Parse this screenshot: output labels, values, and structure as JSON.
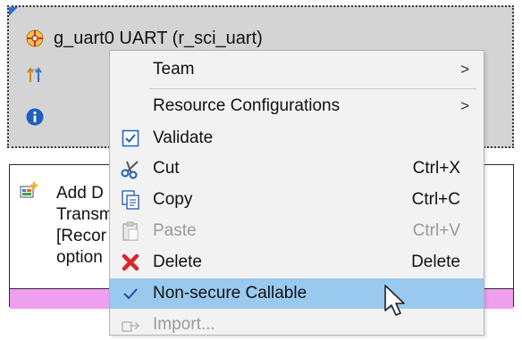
{
  "stack": {
    "title": "g_uart0 UART (r_sci_uart)",
    "icons": [
      "module-icon",
      "stack-tree-icon",
      "info-icon"
    ]
  },
  "description": {
    "lines": [
      "Add D",
      "Transm",
      "[Recor",
      "option"
    ]
  },
  "menu": {
    "items": [
      {
        "id": "team",
        "label": "Team",
        "shortcut": "",
        "submenu": true,
        "enabled": true,
        "icon": ""
      },
      {
        "id": "resource-configurations",
        "label": "Resource Configurations",
        "shortcut": "",
        "submenu": true,
        "enabled": true,
        "icon": ""
      },
      {
        "id": "validate",
        "label": "Validate",
        "shortcut": "",
        "submenu": false,
        "enabled": true,
        "icon": "checkbox-icon"
      },
      {
        "id": "cut",
        "label": "Cut",
        "shortcut": "Ctrl+X",
        "submenu": false,
        "enabled": true,
        "icon": "scissors-icon"
      },
      {
        "id": "copy",
        "label": "Copy",
        "shortcut": "Ctrl+C",
        "submenu": false,
        "enabled": true,
        "icon": "copy-icon"
      },
      {
        "id": "paste",
        "label": "Paste",
        "shortcut": "Ctrl+V",
        "submenu": false,
        "enabled": false,
        "icon": "paste-icon"
      },
      {
        "id": "delete",
        "label": "Delete",
        "shortcut": "Delete",
        "submenu": false,
        "enabled": true,
        "icon": "red-x-icon"
      },
      {
        "id": "non-secure-callable",
        "label": "Non-secure Callable",
        "shortcut": "",
        "submenu": false,
        "enabled": true,
        "checked": true,
        "highlighted": true,
        "icon": "checkmark-icon"
      },
      {
        "id": "import",
        "label": "Import...",
        "shortcut": "",
        "submenu": false,
        "enabled": false,
        "icon": "import-icon"
      }
    ],
    "submenu_glyph": ">"
  },
  "colors": {
    "highlight": "#99c9ef",
    "stack_bg": "#d4d4d4",
    "pink_strip": "#ee9ff0",
    "delete_red": "#d9262b",
    "check_blue": "#1f5fbf"
  }
}
